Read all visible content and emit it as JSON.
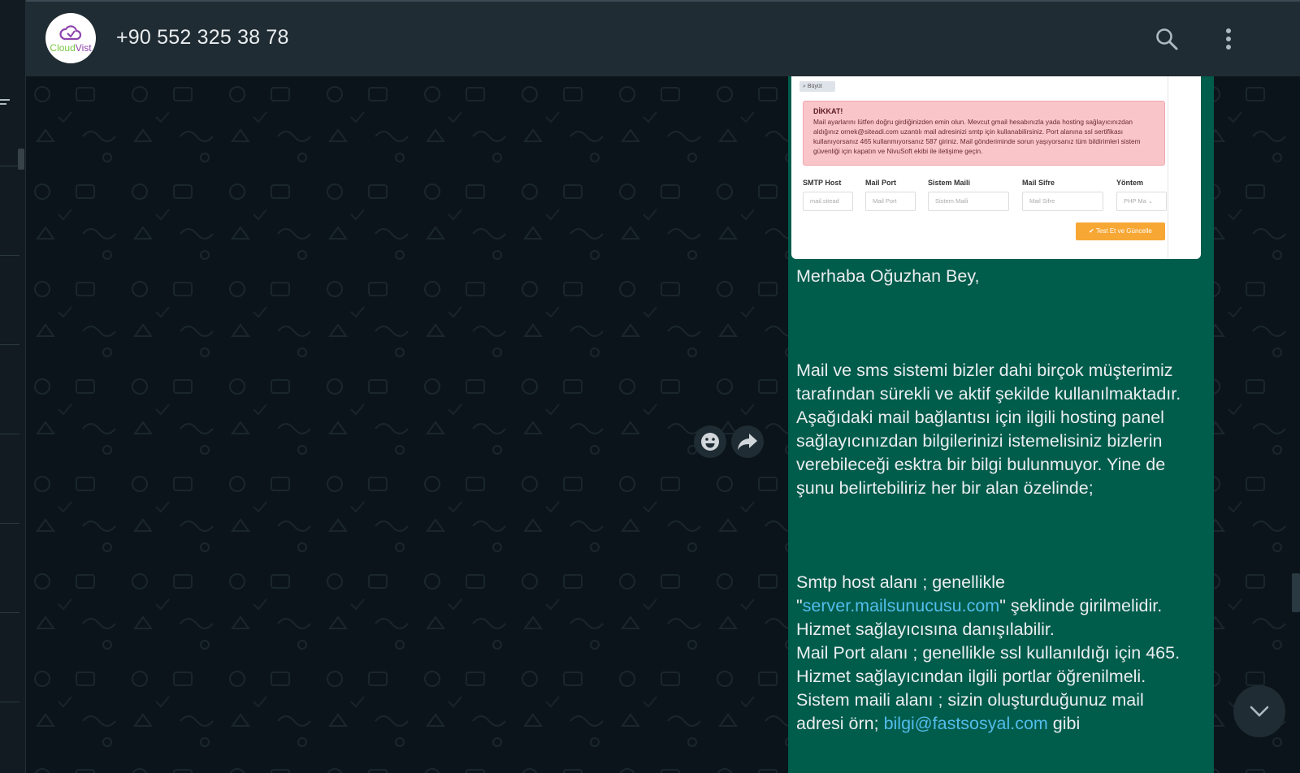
{
  "header": {
    "contact_name": "+90 552 325 38 78",
    "avatar_logo": {
      "cloud": "Cloud",
      "vist": "Vist"
    },
    "icons": [
      "search-icon",
      "menu-dots-icon"
    ]
  },
  "message": {
    "screenshot": {
      "zoom_label": "Büyüt",
      "alert_title": "DİKKAT!",
      "alert_text": "Mail ayarlarını lütfen doğru girdiğinizden emin olun. Mevcut gmail hesabınızla yada hosting sağlayıcınızdan aldığınız ornek@siteadi.com uzantılı mail adresinizi smtp için kullanabilirsiniz. Port alanına ssl sertifikası kullanıyorsanız 465 kullanmıyorsanız 587 giriniz. Mail gönderiminde sorun yaşıyorsanız tüm bildirimleri sistem güvenliği için kapatın ve NivuSoft ekibi ile iletişime geçin.",
      "fields": [
        {
          "label": "SMTP Host",
          "placeholder": "mail.sitead"
        },
        {
          "label": "Mail Port",
          "placeholder": "Mail Port"
        },
        {
          "label": "Sistem Maili",
          "placeholder": "Sistem Maili"
        },
        {
          "label": "Mail Sifre",
          "placeholder": "Mail Sifre"
        },
        {
          "label": "Yöntem",
          "placeholder": "PHP Ma"
        }
      ],
      "button_label": "✔ Test Et ve Güncelle"
    },
    "greeting": "Merhaba Oğuzhan Bey,",
    "paragraph1": "Mail ve sms sistemi bizler dahi birçok müşterimiz tarafından sürekli ve aktif şekilde kullanılmaktadır. Aşağıdaki mail bağlantısı için ilgili hosting panel sağlayıcınızdan bilgilerinizi istemelisiniz bizlerin verebileceği esktra bir bilgi bulunmuyor. Yine de şunu belirtebiliriz her bir alan özelinde;",
    "smtp_line_start": "Smtp host alanı ; genellikle",
    "smtp_quote_open": "\"",
    "smtp_link": "server.mailsunucusu.com",
    "smtp_line_end": "\" şeklinde girilmelidir.",
    "smtp_note": "Hizmet sağlayıcısına danışılabilir.",
    "port_line": "Mail Port alanı ; genellikle ssl kullanıldığı için 465.",
    "port_note": "Hizmet sağlayıcından ilgili portlar öğrenilmeli.",
    "system_line": "Sistem maili alanı ; sizin oluşturduğunuz mail",
    "system_example_prefix": "adresi örn; ",
    "system_example_link": "bilgi@fastsosyal.com",
    "system_example_suffix": " gibi"
  },
  "actions": {
    "react_icon": "emoji-icon",
    "forward_icon": "forward-icon",
    "scroll_icon": "chevron-down-icon"
  },
  "colors": {
    "header_bg": "#202c33",
    "chat_bg": "#0b141a",
    "bubble_bg": "#005c4b",
    "text": "#e9edef",
    "link": "#53bdeb",
    "alert_bg": "#f9c5c9",
    "button_bg": "#f7a734"
  }
}
